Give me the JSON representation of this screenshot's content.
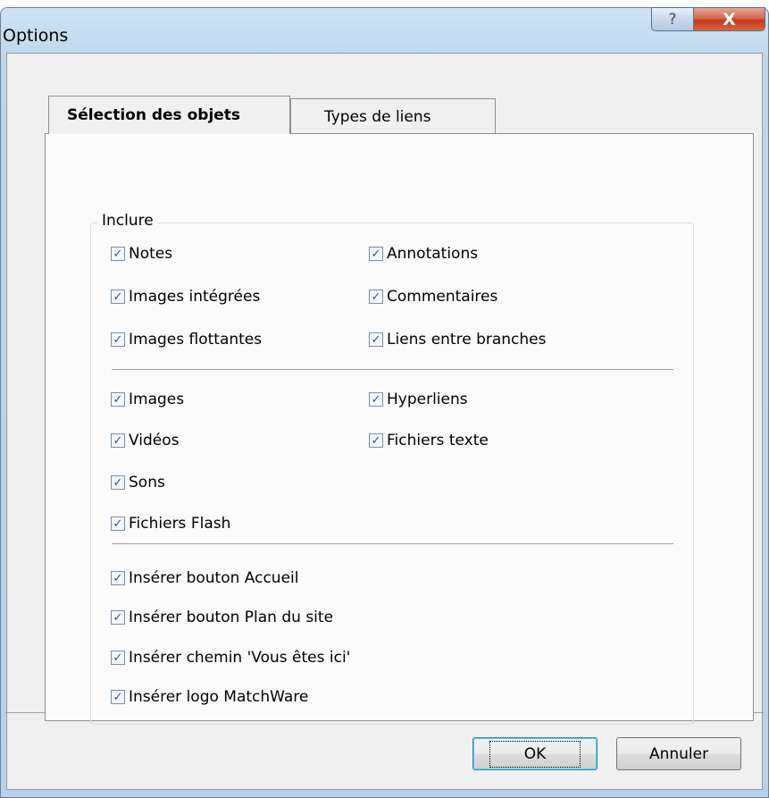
{
  "window": {
    "title": "Options"
  },
  "titlebar": {
    "help_glyph": "?",
    "close_glyph": "X"
  },
  "tabs": [
    {
      "label": "Sélection des objets",
      "active": true
    },
    {
      "label": "Types de liens",
      "active": false
    }
  ],
  "group": {
    "label": "Inclure"
  },
  "section1": [
    {
      "label": "Notes",
      "checked": true
    },
    {
      "label": "Annotations",
      "checked": true
    },
    {
      "label": "Images intégrées",
      "checked": true
    },
    {
      "label": "Commentaires",
      "checked": true
    },
    {
      "label": "Images flottantes",
      "checked": true
    },
    {
      "label": "Liens entre branches",
      "checked": true
    }
  ],
  "section2": [
    {
      "label": "Images",
      "checked": true
    },
    {
      "label": "Hyperliens",
      "checked": true
    },
    {
      "label": "Vidéos",
      "checked": true
    },
    {
      "label": "Fichiers texte",
      "checked": true
    },
    {
      "label": "Sons",
      "checked": true
    },
    {
      "label": "Fichiers Flash",
      "checked": true
    }
  ],
  "section3": [
    {
      "label": "Insérer bouton Accueil",
      "checked": true
    },
    {
      "label": "Insérer bouton Plan du site",
      "checked": true
    },
    {
      "label": "Insérer chemin 'Vous êtes ici'",
      "checked": true
    },
    {
      "label": "Insérer logo MatchWare",
      "checked": true
    }
  ],
  "checkmark_glyph": "✓",
  "buttons": {
    "ok": "OK",
    "cancel": "Annuler"
  },
  "colors": {
    "accent": "#2a4ec0",
    "close_red": "#c3381c"
  }
}
